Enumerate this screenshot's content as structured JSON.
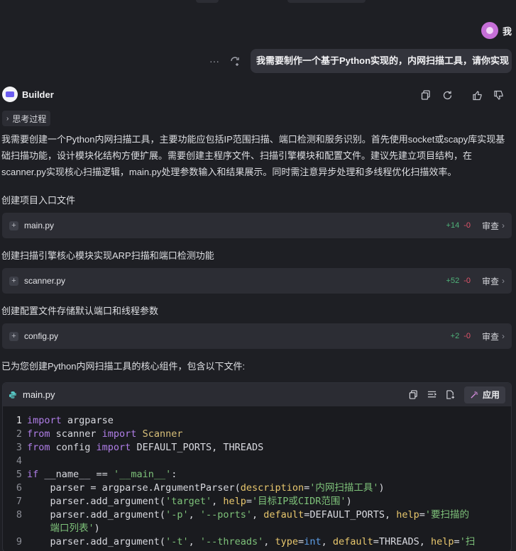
{
  "user": {
    "name": "我",
    "message": "我需要制作一个基于Python实现的，内网扫描工具，请你实现"
  },
  "bot": {
    "name": "Builder",
    "thinking_label": "思考过程",
    "intro": "我需要创建一个Python内网扫描工具，主要功能应包括IP范围扫描、端口检测和服务识别。首先使用socket或scapy库实现基础扫描功能，设计模块化结构方便扩展。需要创建主程序文件、扫描引擎模块和配置文件。建议先建立项目结构，在scanner.py实现核心扫描逻辑，main.py处理参数输入和结果展示。同时需注意异步处理和多线程优化扫描效率。",
    "steps": [
      {
        "caption": "创建项目入口文件",
        "file": "main.py",
        "added": "+14",
        "removed": "-0",
        "review": "审查"
      },
      {
        "caption": "创建扫描引擎核心模块实现ARP扫描和端口检测功能",
        "file": "scanner.py",
        "added": "+52",
        "removed": "-0",
        "review": "审查"
      },
      {
        "caption": "创建配置文件存储默认端口和线程参数",
        "file": "config.py",
        "added": "+2",
        "removed": "-0",
        "review": "审查"
      }
    ],
    "summary": "已为您创建Python内网扫描工具的核心组件，包含以下文件:"
  },
  "code_block": {
    "filename": "main.py",
    "apply_label": "应用",
    "line_numbers": [
      "1",
      "2",
      "3",
      "4",
      "5",
      "6",
      "7",
      "8",
      "",
      "9"
    ],
    "lines": [
      [
        {
          "c": "kw",
          "v": "import"
        },
        {
          "c": "t",
          "v": " argparse"
        }
      ],
      [
        {
          "c": "kw",
          "v": "from"
        },
        {
          "c": "t",
          "v": " scanner "
        },
        {
          "c": "kw",
          "v": "import"
        },
        {
          "c": "t",
          "v": " "
        },
        {
          "c": "cls",
          "v": "Scanner"
        }
      ],
      [
        {
          "c": "kw",
          "v": "from"
        },
        {
          "c": "t",
          "v": " config "
        },
        {
          "c": "kw",
          "v": "import"
        },
        {
          "c": "t",
          "v": " DEFAULT_PORTS, THREADS"
        }
      ],
      [],
      [
        {
          "c": "kw",
          "v": "if"
        },
        {
          "c": "t",
          "v": " __name__ == "
        },
        {
          "c": "str",
          "v": "'__main__'"
        },
        {
          "c": "t",
          "v": ":"
        }
      ],
      [
        {
          "c": "t",
          "v": "    parser = argparse.ArgumentParser("
        },
        {
          "c": "prm",
          "v": "description"
        },
        {
          "c": "t",
          "v": "="
        },
        {
          "c": "str",
          "v": "'内网扫描工具'"
        },
        {
          "c": "t",
          "v": ")"
        }
      ],
      [
        {
          "c": "t",
          "v": "    parser.add_argument("
        },
        {
          "c": "str",
          "v": "'target'"
        },
        {
          "c": "t",
          "v": ", "
        },
        {
          "c": "prm",
          "v": "help"
        },
        {
          "c": "t",
          "v": "="
        },
        {
          "c": "str",
          "v": "'目标IP或CIDR范围'"
        },
        {
          "c": "t",
          "v": ")"
        }
      ],
      [
        {
          "c": "t",
          "v": "    parser.add_argument("
        },
        {
          "c": "str",
          "v": "'-p'"
        },
        {
          "c": "t",
          "v": ", "
        },
        {
          "c": "str",
          "v": "'--ports'"
        },
        {
          "c": "t",
          "v": ", "
        },
        {
          "c": "prm",
          "v": "default"
        },
        {
          "c": "t",
          "v": "=DEFAULT_PORTS, "
        },
        {
          "c": "prm",
          "v": "help"
        },
        {
          "c": "t",
          "v": "="
        },
        {
          "c": "str",
          "v": "'要扫描的"
        }
      ],
      [
        {
          "c": "str",
          "v": "    端口列表'"
        },
        {
          "c": "t",
          "v": ")"
        }
      ],
      [
        {
          "c": "t",
          "v": "    parser.add_argument("
        },
        {
          "c": "str",
          "v": "'-t'"
        },
        {
          "c": "t",
          "v": ", "
        },
        {
          "c": "str",
          "v": "'--threads'"
        },
        {
          "c": "t",
          "v": ", "
        },
        {
          "c": "prm",
          "v": "type"
        },
        {
          "c": "t",
          "v": "="
        },
        {
          "c": "bl",
          "v": "int"
        },
        {
          "c": "t",
          "v": ", "
        },
        {
          "c": "prm",
          "v": "default"
        },
        {
          "c": "t",
          "v": "=THREADS, "
        },
        {
          "c": "prm",
          "v": "help"
        },
        {
          "c": "t",
          "v": "="
        },
        {
          "c": "str",
          "v": "'扫"
        }
      ]
    ]
  },
  "colors": {
    "background": "#1e1f24",
    "card": "#2c2d34",
    "added": "#4fb37a",
    "removed": "#e2556b",
    "keyword": "#b07ee8",
    "string": "#7ec27a"
  }
}
